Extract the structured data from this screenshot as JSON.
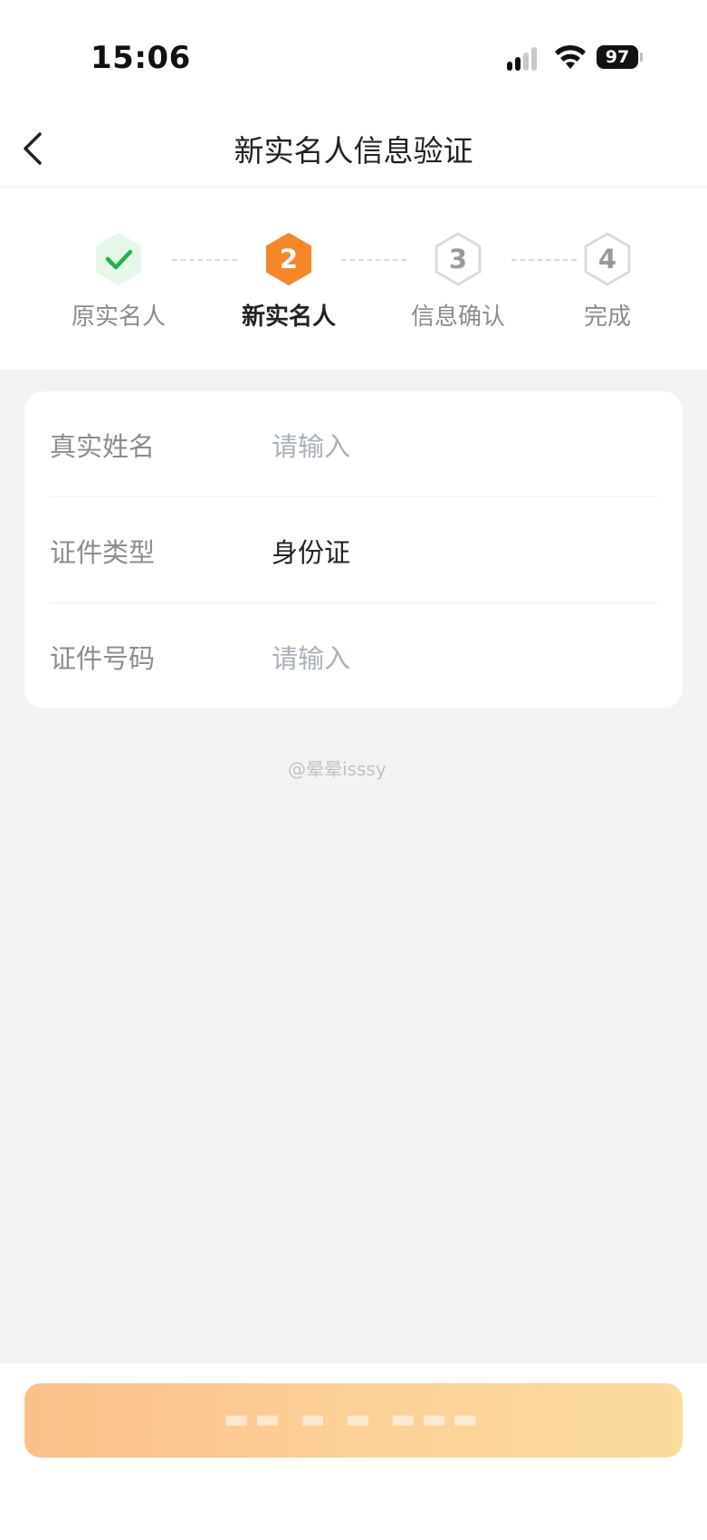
{
  "status_bar": {
    "time": "15:06",
    "battery": "97"
  },
  "nav": {
    "title": "新实名人信息验证",
    "back_icon": "chevron-left-icon"
  },
  "steps": [
    {
      "number": "",
      "label": "原实名人",
      "state": "done",
      "icon": "check-icon"
    },
    {
      "number": "2",
      "label": "新实名人",
      "state": "active"
    },
    {
      "number": "3",
      "label": "信息确认",
      "state": "pending"
    },
    {
      "number": "4",
      "label": "完成",
      "state": "pending"
    }
  ],
  "form": {
    "rows": [
      {
        "label": "真实姓名",
        "placeholder": "请输入",
        "value": ""
      },
      {
        "label": "证件类型",
        "placeholder": "",
        "value": "身份证"
      },
      {
        "label": "证件号码",
        "placeholder": "请输入",
        "value": ""
      }
    ]
  },
  "watermark": "@晕晕isssy",
  "colors": {
    "accent": "#f5862a",
    "done_green": "#22b04b",
    "done_bg": "#e6f7ea",
    "pending_border": "#d9d9d9",
    "page_bg": "#f3f3f3"
  }
}
